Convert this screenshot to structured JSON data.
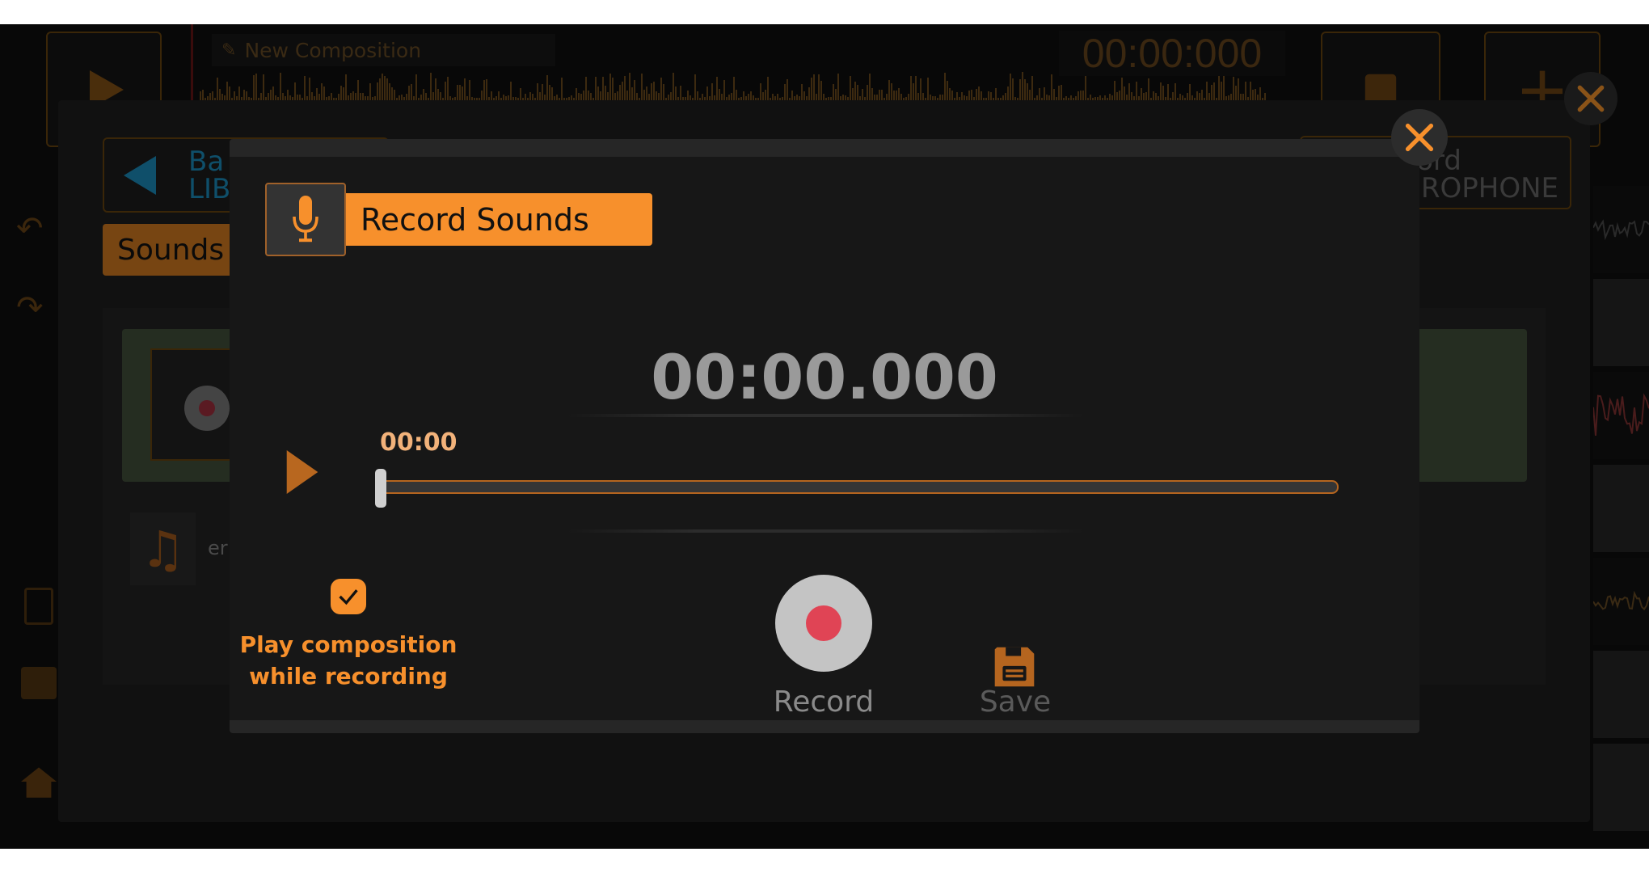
{
  "topbar": {
    "composition_name": "New Composition",
    "timer": "00:00:000"
  },
  "library": {
    "back_button_fragment_1": "Ba",
    "back_button_fragment_2": "LIB",
    "tab_sounds": "Sounds",
    "record_button_fragment_1": "ord",
    "record_button_fragment_2": "CROPHONE",
    "sound_item_label_fragment": "er"
  },
  "dialog": {
    "title": "Record Sounds",
    "timer": "00:00.000",
    "playback_position": "00:00",
    "playback_progress": 0,
    "play_composition_checked": true,
    "play_composition_label_line1": "Play composition",
    "play_composition_label_line2": "while recording",
    "record_label": "Record",
    "save_label": "Save"
  },
  "colors": {
    "accent": "#f7902c",
    "record_dot": "#e04455",
    "back_blue": "#0f6c93"
  },
  "icons": [
    "play-icon",
    "pencil-icon",
    "save-icon",
    "plus-icon",
    "close-icon",
    "undo-icon",
    "redo-icon",
    "file-icon",
    "folder-icon",
    "home-icon",
    "back-arrow-icon",
    "microphone-icon",
    "record-icon",
    "music-note-icon",
    "checkmark-icon"
  ]
}
